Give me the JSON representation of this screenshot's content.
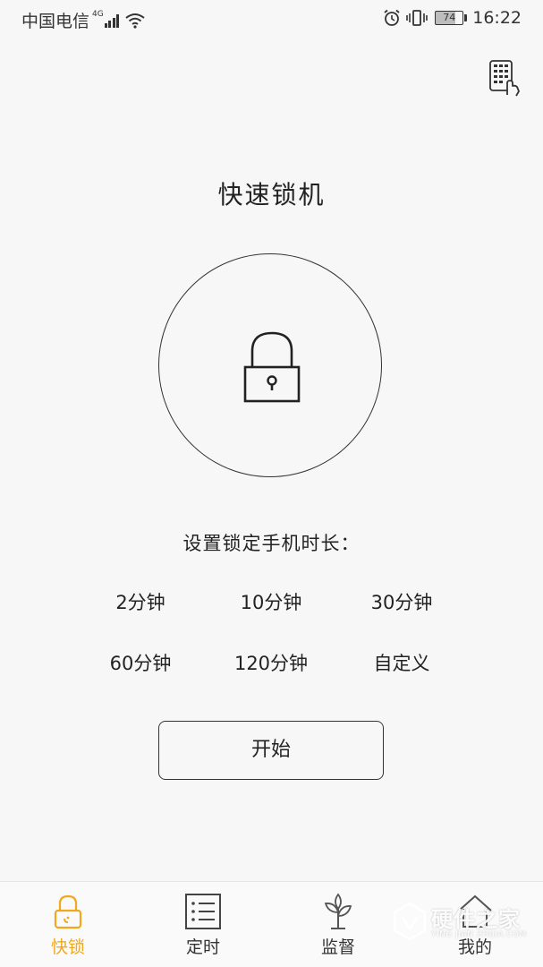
{
  "status_bar": {
    "carrier": "中国电信",
    "network_type": "4G",
    "battery_level": "74",
    "time": "16:22",
    "icons": [
      "signal-icon",
      "wifi-icon",
      "alarm-icon",
      "vibrate-icon",
      "battery-icon"
    ]
  },
  "header": {
    "keypad_icon": "keypad-icon"
  },
  "main": {
    "title": "快速锁机",
    "lock_icon": "padlock-icon",
    "duration_label": "设置锁定手机时长：",
    "options": [
      "2分钟",
      "10分钟",
      "30分钟",
      "60分钟",
      "120分钟",
      "自定义"
    ],
    "start_button": "开始"
  },
  "bottom_nav": {
    "items": [
      {
        "label": "快锁",
        "icon": "lock-icon",
        "active": true
      },
      {
        "label": "定时",
        "icon": "list-icon",
        "active": false
      },
      {
        "label": "监督",
        "icon": "plant-icon",
        "active": false
      },
      {
        "label": "我的",
        "icon": "home-icon",
        "active": false
      }
    ]
  },
  "watermark": {
    "text": "硬件之家",
    "subtext": "YING JIAN ZHIJIA.COM"
  },
  "colors": {
    "accent": "#f2a81d",
    "text": "#222222",
    "background": "#f7f7f7"
  }
}
